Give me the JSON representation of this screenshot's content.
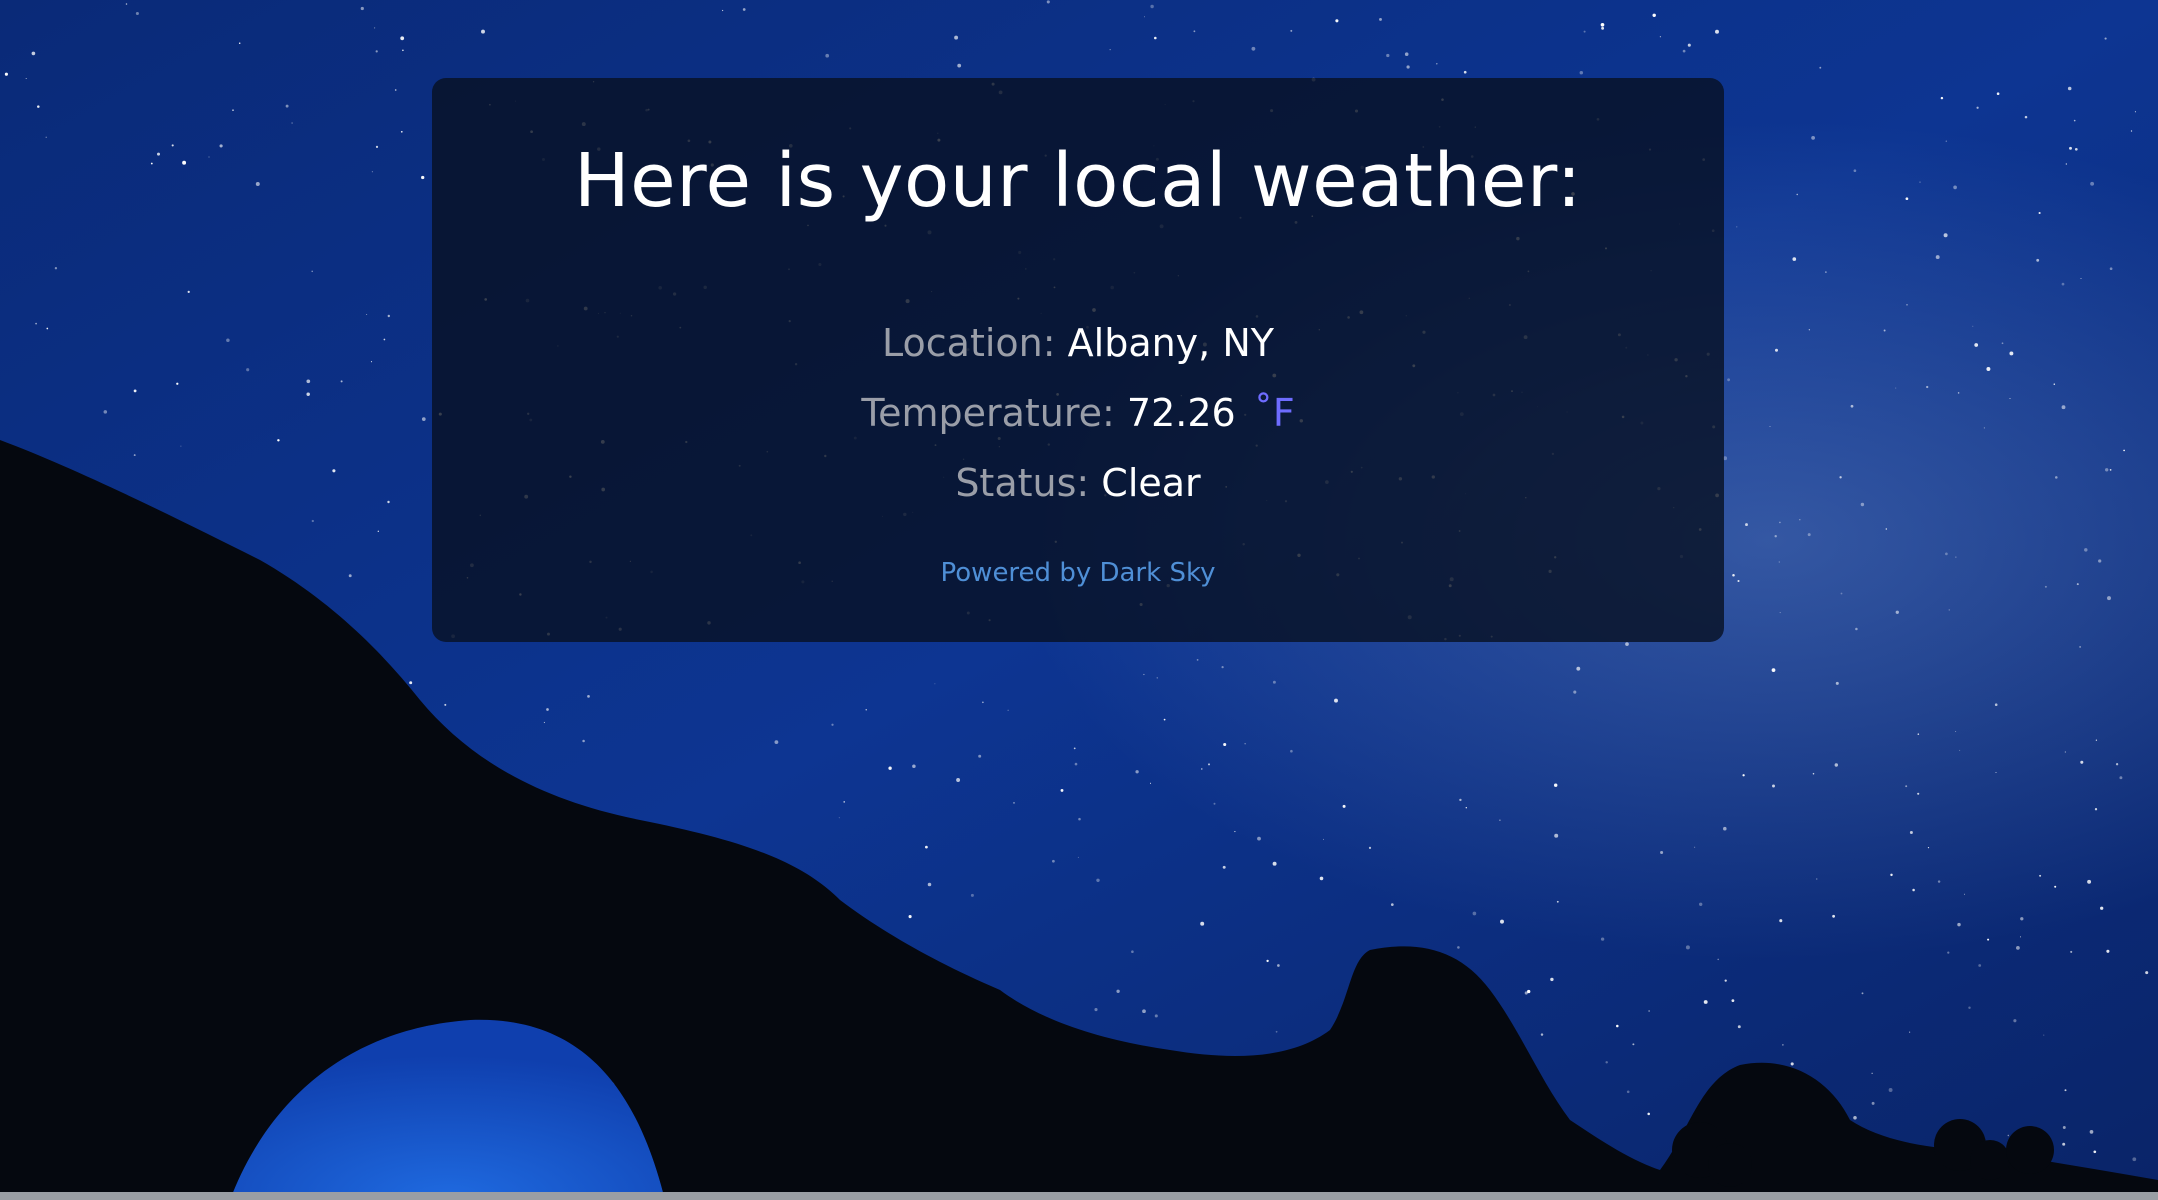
{
  "page": {
    "heading": "Here is your local weather:"
  },
  "weather": {
    "location_label": "Location:",
    "location_value": "Albany, NY",
    "temperature_label": "Temperature:",
    "temperature_value": "72.26",
    "temperature_unit": "˚F",
    "status_label": "Status:",
    "status_value": "Clear"
  },
  "footer": {
    "powered_by": "Powered by Dark Sky"
  },
  "colors": {
    "card_background": "#081022",
    "label_gray": "#9a9ea8",
    "unit_accent": "#6e6cff",
    "link_blue": "#4f8fd6",
    "sky_blue": "#1547b8"
  }
}
